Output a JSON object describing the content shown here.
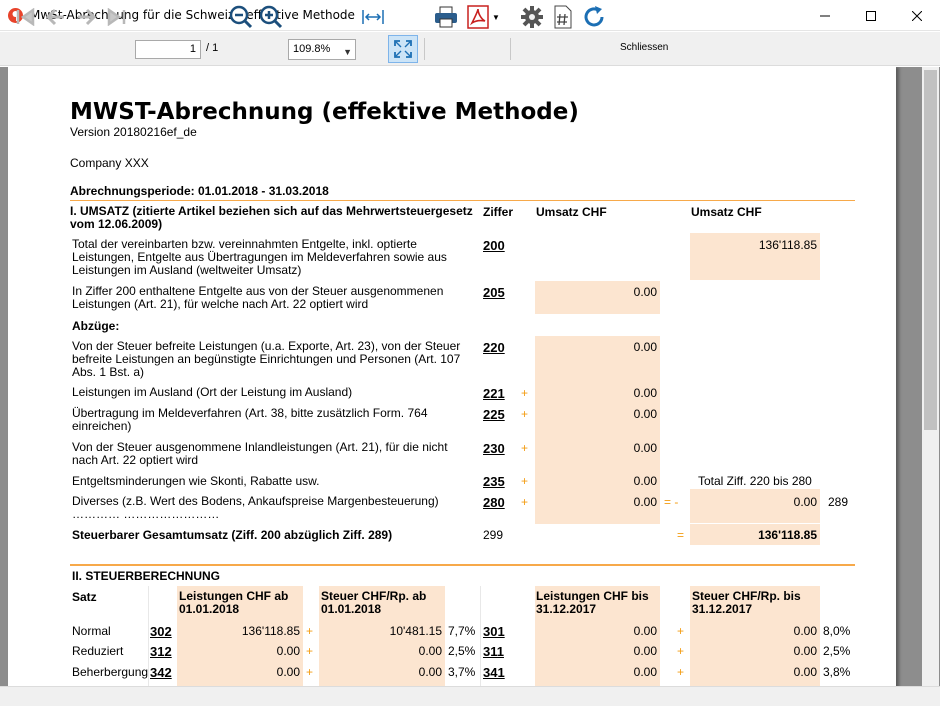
{
  "window": {
    "title": "MwSt-Abrechnung für die Schweiz - effektive Methode",
    "controls": [
      "minimize",
      "maximize",
      "close"
    ]
  },
  "toolbar": {
    "page_current": "1",
    "page_total": "/ 1",
    "zoom": "109.8%",
    "close_label": "Schliessen"
  },
  "doc": {
    "title": "MWST-Abrechnung (effektive Methode)",
    "version": "Version 20180216ef_de",
    "company": "Company XXX",
    "period": "Abrechnungsperiode: 01.01.2018 - 31.03.2018",
    "section1": {
      "heading": "I. UMSATZ (zitierte Artikel beziehen sich auf das Mehrwertsteuergesetz vom 12.06.2009)",
      "col_ziffer": "Ziffer",
      "col_umsatz1": "Umsatz CHF",
      "col_umsatz2": "Umsatz CHF",
      "rows": [
        {
          "text": "Total der vereinbarten bzw. vereinnahmten Entgelte, inkl. optierte Leistungen, Entgelte aus Übertragungen im Meldeverfahren sowie aus Leistungen im Ausland (weltweiter Umsatz)",
          "code": "200",
          "value": "136'118.85"
        },
        {
          "text": "In Ziffer 200 enthaltene Entgelte aus von der Steuer ausgenommenen Leistungen (Art. 21), für welche nach Art. 22 optiert wird",
          "code": "205",
          "value": "0.00"
        },
        {
          "text": "Von der Steuer befreite Leistungen (u.a. Exporte, Art. 23), von der Steuer befreite Leistungen an begünstigte Einrichtungen und Personen (Art. 107 Abs. 1 Bst. a)",
          "code": "220",
          "value": "0.00"
        },
        {
          "text": "Leistungen im Ausland (Ort der Leistung im Ausland)",
          "code": "221",
          "sign": "+",
          "value": "0.00"
        },
        {
          "text": "Übertragung im Meldeverfahren (Art. 38, bitte zusätzlich Form. 764 einreichen)",
          "code": "225",
          "sign": "+",
          "value": "0.00"
        },
        {
          "text": "Von der Steuer ausgenommene Inlandleistungen (Art. 21), für die nicht nach Art. 22 optiert wird",
          "code": "230",
          "sign": "+",
          "value": "0.00"
        },
        {
          "text": "Entgeltsminderungen wie Skonti, Rabatte usw.",
          "code": "235",
          "sign": "+",
          "value": "0.00"
        },
        {
          "text": "Diverses (z.B. Wert des Bodens, Ankaufspreise Margenbesteuerung) ………… ……………………",
          "code": "280",
          "sign": "+",
          "value": "0.00"
        }
      ],
      "abzuege": "Abzüge:",
      "total_label": "Total Ziff. 220 bis 280",
      "total_signs": "= -",
      "total_value": "0.00",
      "total_code": "289",
      "gesamt_label": "Steuerbarer Gesamtumsatz (Ziff. 200 abzüglich Ziff. 289)",
      "gesamt_code": "299",
      "gesamt_sign": "=",
      "gesamt_value": "136'118.85"
    },
    "section2": {
      "heading": "II. STEUERBERECHNUNG",
      "col_satz": "Satz",
      "col_l1": "Leistungen CHF ab 01.01.2018",
      "col_s1": "Steuer CHF/Rp. ab 01.01.2018",
      "col_l2": "Leistungen CHF bis 31.12.2017",
      "col_s2": "Steuer CHF/Rp. bis 31.12.2017",
      "rows": [
        {
          "label": "Normal",
          "code1": "302",
          "l1": "136'118.85",
          "s1": "10'481.15",
          "rate1": "7,7%",
          "code2": "301",
          "l2": "0.00",
          "s2": "0.00",
          "rate2": "8,0%"
        },
        {
          "label": "Reduziert",
          "code1": "312",
          "l1": "0.00",
          "s1": "0.00",
          "rate1": "2,5%",
          "code2": "311",
          "l2": "0.00",
          "s2": "0.00",
          "rate2": "2,5%"
        },
        {
          "label": "Beherbergung",
          "code1": "342",
          "l1": "0.00",
          "s1": "0.00",
          "rate1": "3,7%",
          "code2": "341",
          "l2": "0.00",
          "s2": "0.00",
          "rate2": "3,8%"
        }
      ],
      "plus": "+"
    }
  }
}
